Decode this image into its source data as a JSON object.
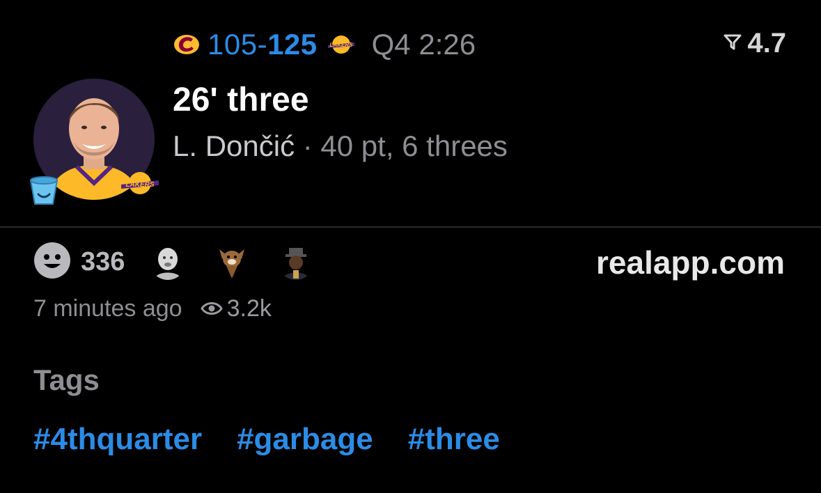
{
  "game": {
    "away_score": "105-",
    "home_score": "125",
    "clock": "Q4 2:26",
    "away_team_icon": "cavaliers-c-logo-icon",
    "home_team_icon": "lakers-logo-icon",
    "colors": {
      "score_blue": "#2b8ce6",
      "cavs_wine": "#860038",
      "cavs_gold": "#fdbb30",
      "lakers_purple": "#552583",
      "lakers_gold": "#fdb927"
    }
  },
  "rating": {
    "value": "4.7",
    "icon": "filter-funnel-icon"
  },
  "play": {
    "title": "26' three",
    "player": "L. Dončić",
    "stats": " · 40 pt, 6 threes"
  },
  "reactions": {
    "count": "336",
    "icon": "smiley-face-icon"
  },
  "source": {
    "domain": "realapp.com"
  },
  "meta": {
    "time_ago": "7 minutes ago",
    "views": "3.2k",
    "views_icon": "eye-icon"
  },
  "tags": {
    "heading": "Tags",
    "items": [
      "#4thquarter",
      "#garbage",
      "#three"
    ]
  }
}
